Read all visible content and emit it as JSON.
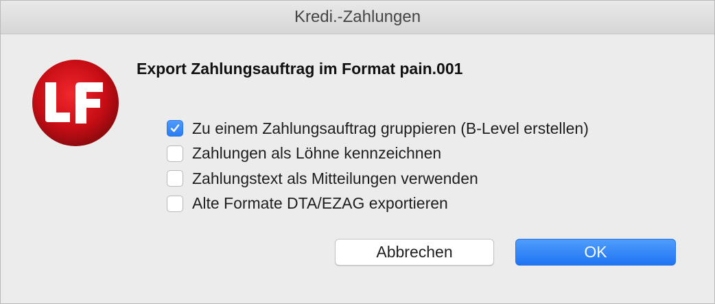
{
  "window": {
    "title": "Kredi.-Zahlungen"
  },
  "logo": {
    "icon": "lf-logo-icon",
    "colors": {
      "primary": "#d0101a",
      "text": "#ffffff"
    }
  },
  "dialog": {
    "heading": "Export Zahlungsauftrag im Format pain.001",
    "options": [
      {
        "label": "Zu einem Zahlungsauftrag gruppieren (B-Level erstellen)",
        "checked": true
      },
      {
        "label": "Zahlungen als Löhne kennzeichnen",
        "checked": false
      },
      {
        "label": "Zahlungstext als Mitteilungen verwenden",
        "checked": false
      },
      {
        "label": "Alte Formate DTA/EZAG exportieren",
        "checked": false
      }
    ],
    "buttons": {
      "cancel_label": "Abbrechen",
      "ok_label": "OK"
    }
  },
  "colors": {
    "accent": "#2a7cf6",
    "window_background": "#ececec"
  }
}
